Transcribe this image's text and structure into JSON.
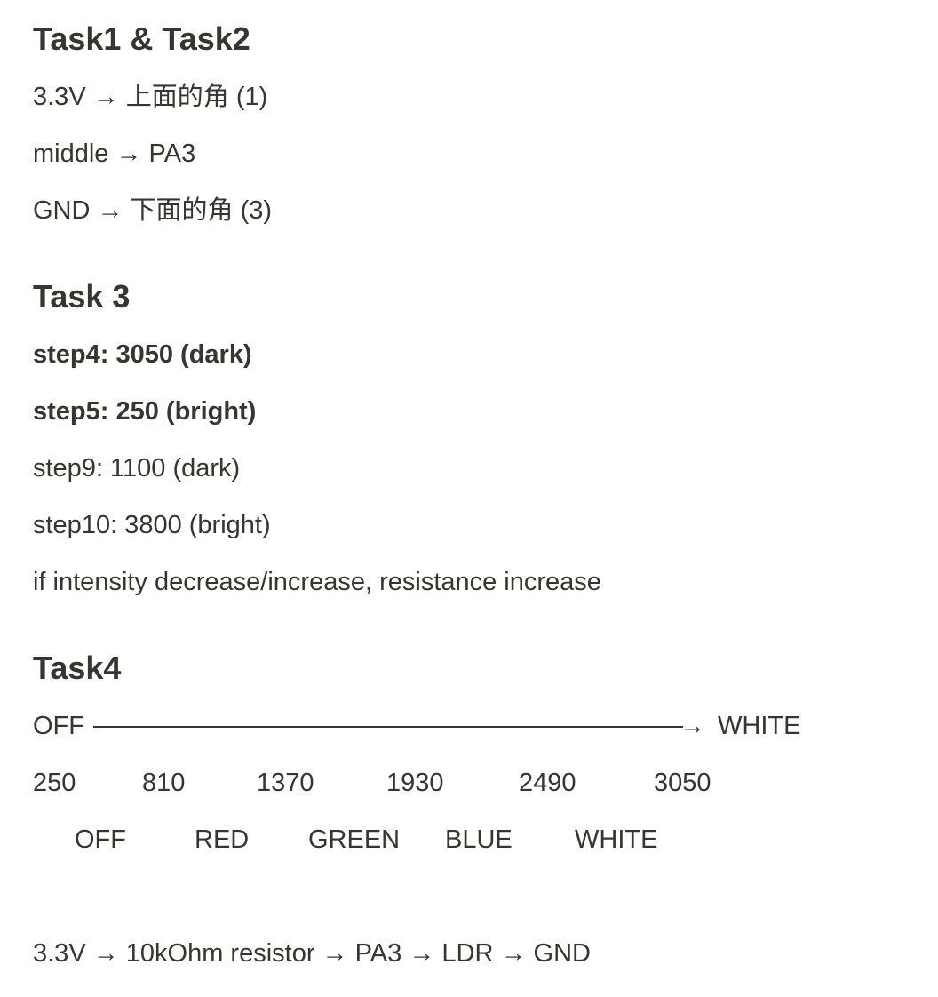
{
  "sections": {
    "s1": {
      "heading": "Task1 & Task2",
      "lines": [
        "3.3V → 上面的角 (1)",
        "middle → PA3",
        "GND → 下面的角 (3)"
      ]
    },
    "s2": {
      "heading": "Task 3",
      "bold_lines": [
        "step4: 3050 (dark)",
        "step5: 250 (bright)"
      ],
      "lines": [
        "step9: 1100 (dark)",
        "step10: 3800 (bright)",
        "if intensity decrease/increase, resistance increase"
      ]
    },
    "s3": {
      "heading": "Task4",
      "scale": {
        "start": "OFF",
        "arrow": "→",
        "end": "WHITE"
      },
      "thresholds": [
        "250",
        "810",
        "1370",
        "1930",
        "2490",
        "3050"
      ],
      "colors": [
        "OFF",
        "RED",
        "GREEN",
        "BLUE",
        "WHITE"
      ],
      "circuit": "3.3V → 10kOhm resistor → PA3 → LDR → GND"
    }
  }
}
